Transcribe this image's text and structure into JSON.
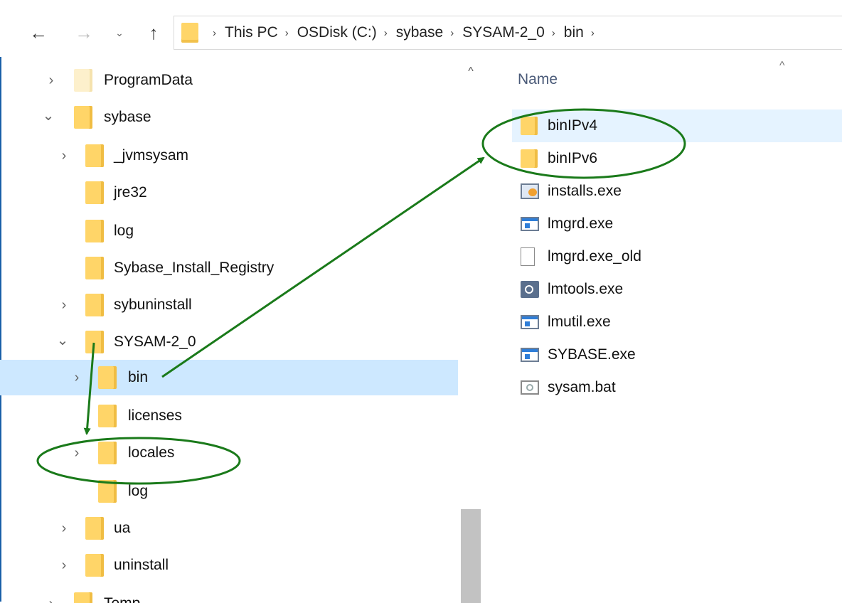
{
  "nav": {
    "back_icon": "arrow-left-icon",
    "forward_icon": "arrow-right-icon",
    "recent_icon": "chevron-down-icon",
    "up_icon": "arrow-up-icon"
  },
  "breadcrumb": {
    "items": [
      "This PC",
      "OSDisk (C:)",
      "sybase",
      "SYSAM-2_0",
      "bin"
    ],
    "separator": "›"
  },
  "tree": {
    "items": [
      {
        "label": "ProgramData",
        "chevron": "›",
        "level": 0
      },
      {
        "label": "sybase",
        "chevron": "⌄",
        "level": 0
      },
      {
        "label": "_jvmsysam",
        "chevron": "›",
        "level": 1
      },
      {
        "label": "jre32",
        "chevron": "",
        "level": 1
      },
      {
        "label": "log",
        "chevron": "",
        "level": 1
      },
      {
        "label": "Sybase_Install_Registry",
        "chevron": "",
        "level": 1
      },
      {
        "label": "sybuninstall",
        "chevron": "›",
        "level": 1
      },
      {
        "label": "SYSAM-2_0",
        "chevron": "⌄",
        "level": 1
      },
      {
        "label": "bin",
        "chevron": "›",
        "level": 2,
        "selected": true
      },
      {
        "label": "licenses",
        "chevron": "",
        "level": 2
      },
      {
        "label": "locales",
        "chevron": "›",
        "level": 2
      },
      {
        "label": "log",
        "chevron": "",
        "level": 2
      },
      {
        "label": "ua",
        "chevron": "›",
        "level": 1
      },
      {
        "label": "uninstall",
        "chevron": "›",
        "level": 1
      },
      {
        "label": "Temp",
        "chevron": "›",
        "level": 0
      }
    ]
  },
  "filelist": {
    "column_name": "Name",
    "sort_caret": "^",
    "files": [
      {
        "name": "binIPv4",
        "icon": "folder-icon"
      },
      {
        "name": "binIPv6",
        "icon": "folder-icon"
      },
      {
        "name": "installs.exe",
        "icon": "installer-icon"
      },
      {
        "name": "lmgrd.exe",
        "icon": "exe-icon"
      },
      {
        "name": "lmgrd.exe_old",
        "icon": "document-icon"
      },
      {
        "name": "lmtools.exe",
        "icon": "tools-icon"
      },
      {
        "name": "lmutil.exe",
        "icon": "exe-icon"
      },
      {
        "name": "SYBASE.exe",
        "icon": "exe-icon"
      },
      {
        "name": "sysam.bat",
        "icon": "batch-file-icon"
      }
    ]
  },
  "scrollbar": {
    "up_arrow": "^"
  },
  "annotation": {
    "color": "#1a7a1a"
  }
}
